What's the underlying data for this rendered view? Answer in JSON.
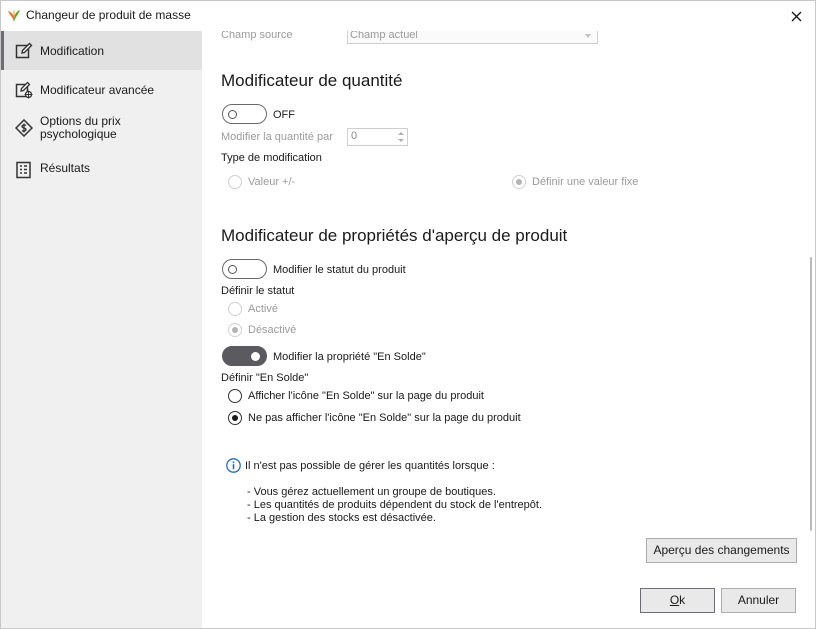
{
  "window": {
    "title": "Changeur de produit de masse"
  },
  "sidebar": {
    "items": [
      {
        "label": "Modification",
        "icon": "edit-icon",
        "active": true
      },
      {
        "label": "Modificateur avancée",
        "icon": "advanced-edit-icon",
        "active": false
      },
      {
        "label": "Options du prix psychologique",
        "icon": "price-tag-icon",
        "active": false
      },
      {
        "label": "Résultats",
        "icon": "results-list-icon",
        "active": false
      }
    ]
  },
  "source_field": {
    "label": "Champ source",
    "value": "Champ actuel"
  },
  "quantity_section": {
    "title": "Modificateur de quantité",
    "toggle_label": "OFF",
    "toggle_on": false,
    "modify_label": "Modifier la quantité par",
    "modify_value": "0",
    "type_label": "Type de modification",
    "option_relative": "Valeur +/-",
    "option_fixed": "Définir une valeur fixe",
    "selected": "fixed"
  },
  "preview_section": {
    "title": "Modificateur de propriétés d'aperçu de produit",
    "status_toggle_label": "Modifier le statut du produit",
    "status_toggle_on": false,
    "status_label": "Définir le statut",
    "status_active": "Activé",
    "status_inactive": "Désactivé",
    "status_selected": "inactive",
    "sale_toggle_label": "Modifier la propriété \"En Solde\"",
    "sale_toggle_on": true,
    "sale_label": "Définir \"En Solde\"",
    "sale_show": "Afficher l'icône \"En Solde\" sur la page du produit",
    "sale_hide": "Ne pas afficher l'icône \"En Solde\" sur la page du produit",
    "sale_selected": "hide"
  },
  "info": {
    "heading": "Il n'est pas possible de gérer les quantités lorsque :",
    "lines": [
      "- Vous gérez actuellement un groupe de boutiques.",
      "- Les quantités de produits dépendent du stock de l'entrepôt.",
      "- La gestion des stocks est désactivée."
    ]
  },
  "buttons": {
    "preview": "Aperçu des changements",
    "ok": "Ok",
    "cancel": "Annuler"
  },
  "colors": {
    "sidebar_bg": "#f0f0f0",
    "active_item_bg": "#e1e1e1",
    "accent": "#5a5a60",
    "info_blue": "#2a6ebb"
  }
}
